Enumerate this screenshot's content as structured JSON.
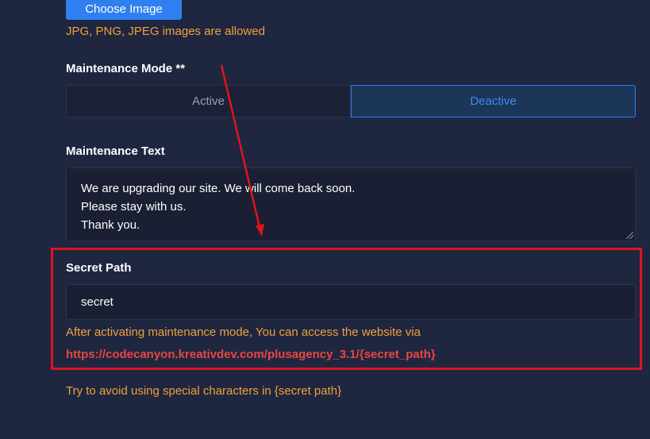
{
  "image_upload": {
    "button_label": "Choose Image",
    "hint": "JPG, PNG, JPEG images are allowed"
  },
  "maintenance_mode": {
    "label": "Maintenance Mode **",
    "options": [
      "Active",
      "Deactive"
    ],
    "selected": "Deactive"
  },
  "maintenance_text": {
    "label": "Maintenance Text",
    "lines": [
      "We are upgrading our site. We will come back soon.",
      "Please stay with us.",
      "Thank you."
    ]
  },
  "secret_path": {
    "label": "Secret Path",
    "value": "secret",
    "note": "After activating maintenance mode, You can access the website via",
    "url": "https://codecanyon.kreativdev.com/plusagency_3.1/{secret_path}",
    "warning": "Try to avoid using special characters in {secret path}"
  },
  "annotation": {
    "color": "#e0141e"
  },
  "colors": {
    "background": "#1f2640",
    "primary": "#2f7ff0",
    "hint": "#f0a13c",
    "link": "#e8473f"
  }
}
